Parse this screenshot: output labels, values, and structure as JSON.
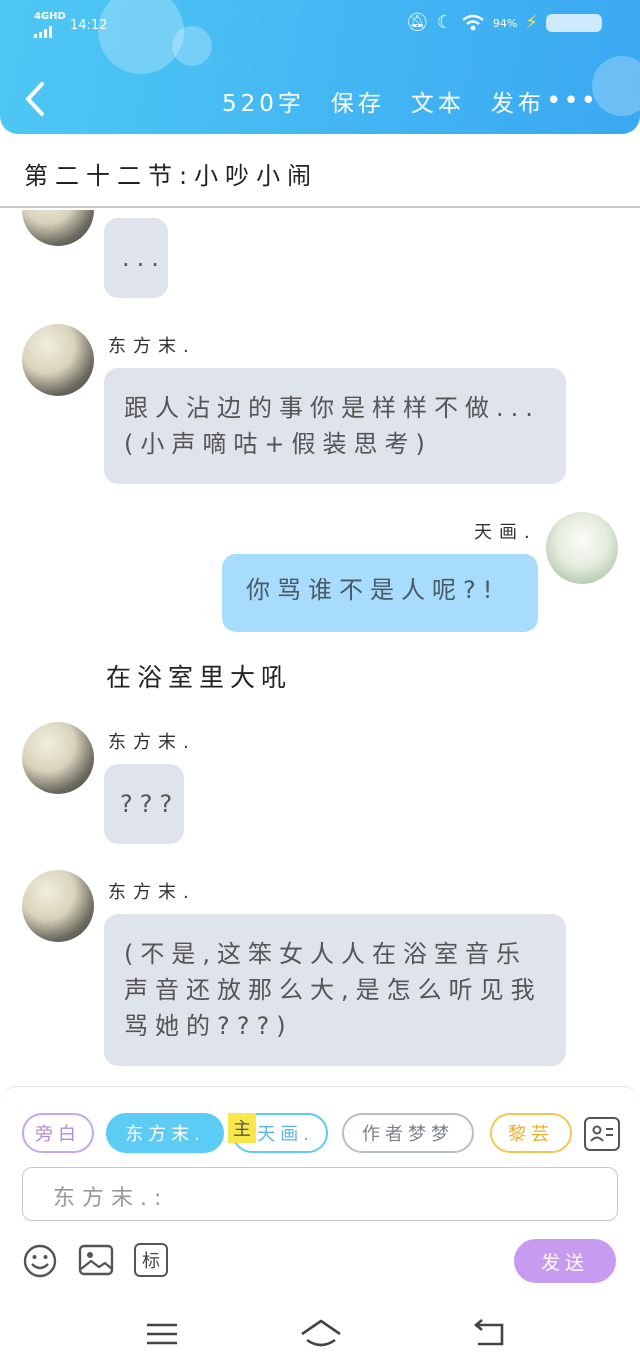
{
  "status_bar": {
    "network": "4GHD",
    "time": "14:12",
    "battery": "94%"
  },
  "header": {
    "word_count": "520字",
    "save_label": "保存",
    "text_label": "文本",
    "publish_label": "发布",
    "more_label": "•••"
  },
  "chapter": {
    "title": "第二十二节:小吵小闹"
  },
  "messages": [
    {
      "speaker": "",
      "text": "..."
    },
    {
      "speaker": "东方末.",
      "text": "跟人沾边的事你是样样不做...(小声嘀咕+假装思考)"
    },
    {
      "speaker": "天画.",
      "text": "你骂谁不是人呢?!"
    },
    {
      "narration": "在浴室里大吼"
    },
    {
      "speaker": "东方末.",
      "text": "???"
    },
    {
      "speaker": "东方末.",
      "text": "(不是,这笨女人人在浴室音乐声音还放那么大,是怎么听见我骂她的???)"
    }
  ],
  "characters": {
    "narrator": "旁白",
    "a": "东方末.",
    "main_badge": "主",
    "b": "天画.",
    "c": "作者梦梦",
    "d": "黎芸"
  },
  "input": {
    "placeholder": "东方末.:"
  },
  "actions": {
    "send_label": "发送",
    "mark_label": "标"
  },
  "colors": {
    "header_start": "#4ec8f4",
    "header_end": "#3aa8f2",
    "other_bubble": "#dfe4ec",
    "my_bubble": "#a8dcfc",
    "send": "#c79cf0"
  }
}
